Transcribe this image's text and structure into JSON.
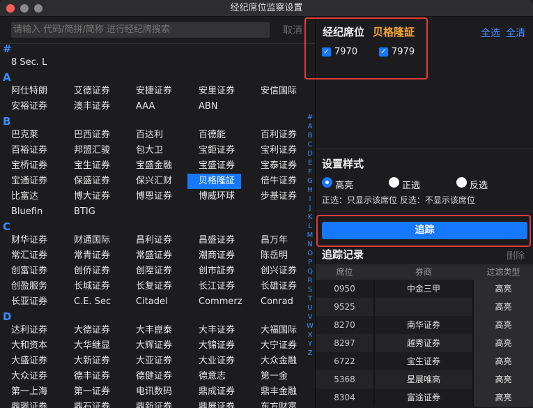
{
  "window": {
    "title": "经纪席位监察设置"
  },
  "search": {
    "placeholder": "请输入 代码/简拼/简称 进行经纪牌搜索",
    "cancel": "取消"
  },
  "brokers": {
    "groups": [
      {
        "letter": "#",
        "items": [
          "8 Sec. L"
        ]
      },
      {
        "letter": "A",
        "items": [
          "阿仕特朗",
          "艾德证券",
          "安捷证券",
          "安里证券",
          "安信国际",
          "安裕证券",
          "澳丰证券",
          "AAA",
          "ABN"
        ]
      },
      {
        "letter": "B",
        "items": [
          "巴克莱",
          "巴西证券",
          "百达利",
          "百德能",
          "百利证券",
          "百裕证券",
          "邦盟汇骏",
          "包大卫",
          "宝鉅证券",
          "宝利证券",
          "宝桥证券",
          "宝生证券",
          "宝盛金融",
          "宝盛证券",
          "宝泰证券",
          "宝通证券",
          "保盛证券",
          "保兴汇财",
          "贝格隆証",
          "倍牛证券",
          "比富达",
          "博大证券",
          "博恩证券",
          "博威环球",
          "步基证券",
          "Bluefin",
          "BTIG"
        ]
      },
      {
        "letter": "C",
        "items": [
          "财华证券",
          "财通国际",
          "昌利证券",
          "昌盛证券",
          "昌万年",
          "常汇证券",
          "常青证券",
          "常盛证券",
          "潮商证券",
          "陈岳明",
          "创富证券",
          "创侨证券",
          "创陞证券",
          "创市証券",
          "创兴证券",
          "创盈服务",
          "长城证券",
          "长复证券",
          "长江证券",
          "长雄证券",
          "长亚证券",
          "C.E. Sec",
          "Citadel",
          "Commerz",
          "Conrad"
        ]
      },
      {
        "letter": "D",
        "items": [
          "达利证券",
          "大德证券",
          "大丰崑泰",
          "大丰证券",
          "大福国际",
          "大和资本",
          "大华继显",
          "大辉证券",
          "大锦证券",
          "大宁证券",
          "大盛证券",
          "大新证券",
          "大亚证券",
          "大业证券",
          "大众金融",
          "大众证券",
          "德丰证券",
          "德健证券",
          "德意志",
          "第一金",
          "第一上海",
          "第一证券",
          "电讯数码",
          "鼎成证券",
          "鼎丰金融",
          "鼎珮证券",
          "鼎石证券",
          "鼎新证券",
          "鼎展证券",
          "东方财富"
        ]
      }
    ],
    "selected": "贝格隆証",
    "index_letters": [
      "#",
      "A",
      "B",
      "C",
      "D",
      "E",
      "F",
      "G",
      "H",
      "I",
      "J",
      "K",
      "L",
      "M",
      "N",
      "O",
      "P",
      "Q",
      "R",
      "S",
      "T",
      "U",
      "V",
      "W",
      "X",
      "Y",
      "Z"
    ]
  },
  "seat": {
    "title": "经纪席位",
    "broker_name": "贝格隆証",
    "select_all": "全选",
    "clear_all": "全清",
    "codes": [
      {
        "code": "7970",
        "checked": true
      },
      {
        "code": "7979",
        "checked": true
      }
    ],
    "highlight_color": "#e23b3b"
  },
  "style": {
    "title": "设置样式",
    "options": [
      {
        "label": "高亮",
        "selected": true
      },
      {
        "label": "正选",
        "selected": false
      },
      {
        "label": "反选",
        "selected": false
      }
    ],
    "note": "正选：只显示该席位   反选：不显示该席位"
  },
  "track_button": {
    "label": "追踪"
  },
  "records": {
    "title": "追踪记录",
    "delete": "删除",
    "headers": [
      "席位",
      "券商",
      "过滤类型"
    ],
    "rows": [
      [
        "0950",
        "中金三甲",
        "高亮"
      ],
      [
        "9525",
        "",
        "高亮"
      ],
      [
        "8270",
        "南华证券",
        "高亮"
      ],
      [
        "8297",
        "越秀证券",
        "高亮"
      ],
      [
        "6722",
        "宝生证券",
        "高亮"
      ],
      [
        "5368",
        "星展唯高",
        "高亮"
      ],
      [
        "8304",
        "富途证券",
        "高亮"
      ]
    ]
  },
  "colors": {
    "accent": "#1677ff",
    "broker_name": "#f5a623",
    "index": "#3a8dff"
  }
}
